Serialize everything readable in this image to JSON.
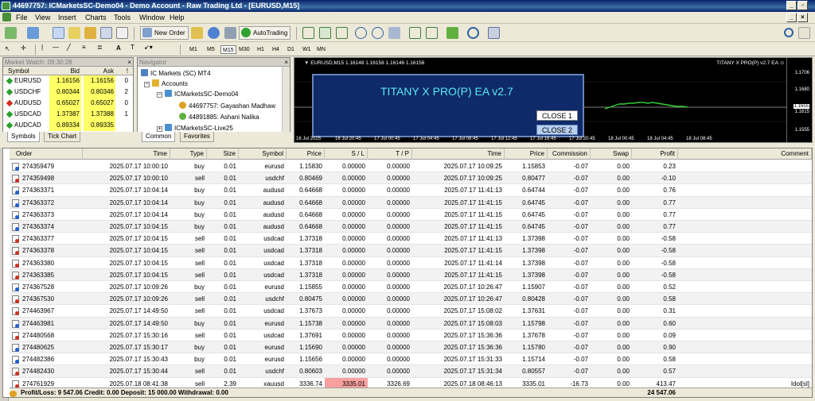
{
  "window": {
    "title": "44697757: ICMarketsSC-Demo04 - Demo Account - Raw Trading Ltd - [EURUSD,M15]"
  },
  "menu": [
    "File",
    "View",
    "Insert",
    "Charts",
    "Tools",
    "Window",
    "Help"
  ],
  "toolbar": {
    "new_order": "New Order",
    "auto_trading": "AutoTrading"
  },
  "timeframes": [
    "M1",
    "M5",
    "M15",
    "M30",
    "H1",
    "H4",
    "D1",
    "W1",
    "MN"
  ],
  "active_timeframe": "M15",
  "market_watch": {
    "title": "Market Watch: 09:30:28",
    "headers": {
      "symbol": "Symbol",
      "bid": "Bid",
      "ask": "Ask",
      "spread": "!"
    },
    "rows": [
      {
        "symbol": "EURUSD",
        "bid": "1.16156",
        "ask": "1.16156",
        "spread": "0",
        "icon_color": "#2aa02a",
        "bid_bg": "#ffff66",
        "ask_bg": "#ffff66"
      },
      {
        "symbol": "USDCHF",
        "bid": "0.80344",
        "ask": "0.80346",
        "spread": "2",
        "icon_color": "#2aa02a",
        "bid_bg": "#ffff66",
        "ask_bg": "#ffff66"
      },
      {
        "symbol": "AUDUSD",
        "bid": "0.65027",
        "ask": "0.65027",
        "spread": "0",
        "icon_color": "#d03020",
        "bid_bg": "#ffff66",
        "ask_bg": "#ffff66"
      },
      {
        "symbol": "USDCAD",
        "bid": "1.37387",
        "ask": "1.37388",
        "spread": "1",
        "icon_color": "#2aa02a",
        "bid_bg": "#ffff66",
        "ask_bg": "#ffff66"
      },
      {
        "symbol": "AUDCAD",
        "bid": "0.89334",
        "ask": "0.89335",
        "spread": "",
        "icon_color": "#2aa02a",
        "bid_bg": "#ffff66",
        "ask_bg": "#ffff66"
      }
    ],
    "tabs": [
      "Symbols",
      "Tick Chart"
    ]
  },
  "navigator": {
    "title": "Navigator",
    "root": "IC Markets (SC) MT4",
    "accounts": "Accounts",
    "server1": "ICMarketsSC-Demo04",
    "account1": "44697757: Gayashan Madhaw",
    "account2": "44891885: Ashani Nalika",
    "server2": "ICMarketsSC-Live25",
    "tabs": [
      "Common",
      "Favorites"
    ]
  },
  "chart": {
    "info": "EURUSD,M15  1.16148 1.16158 1.16146 1.16156",
    "ea_label": "TITANY X PRO(P) v2.7 EA",
    "ea_title": "TITANY X PRO(P) EA v2.7",
    "close1": "CLOSE 1",
    "close2": "CLOSE 2",
    "prices": [
      "1.1706",
      "1.1680",
      "1.1655",
      "1.1615",
      "1.1555"
    ],
    "times": [
      "16 Jul 2025",
      "16 Jul 20:45",
      "17 Jul 00:45",
      "17 Jul 04:45",
      "17 Jul 08:45",
      "17 Jul 12:45",
      "17 Jul 16:45",
      "17 Jul 20:45",
      "18 Jul 00:45",
      "18 Jul 04:45",
      "18 Jul 08:45"
    ]
  },
  "terminal": {
    "headers": {
      "order": "Order",
      "time": "Time",
      "type": "Type",
      "size": "Size",
      "symbol": "Symbol",
      "price": "Price",
      "sl": "S / L",
      "tp": "T / P",
      "time2": "Time",
      "price2": "Price",
      "commission": "Commission",
      "swap": "Swap",
      "profit": "Profit",
      "comment": "Comment"
    },
    "rows": [
      {
        "order": "274359479",
        "time": "2025.07.17 10:00:10",
        "type": "buy",
        "size": "0.01",
        "symbol": "eurusd",
        "price": "1.15830",
        "sl": "0.00000",
        "tp": "0.00000",
        "time2": "2025.07.17 10:09:25",
        "price2": "1.15853",
        "commission": "-0.07",
        "swap": "0.00",
        "profit": "0.23",
        "comment": ""
      },
      {
        "order": "274359498",
        "time": "2025.07.17 10:00:10",
        "type": "sell",
        "size": "0.01",
        "symbol": "usdchf",
        "price": "0.80469",
        "sl": "0.00000",
        "tp": "0.00000",
        "time2": "2025.07.17 10:09:25",
        "price2": "0.80477",
        "commission": "-0.07",
        "swap": "0.00",
        "profit": "-0.10",
        "comment": ""
      },
      {
        "order": "274363371",
        "time": "2025.07.17 10:04:14",
        "type": "buy",
        "size": "0.01",
        "symbol": "audusd",
        "price": "0.64668",
        "sl": "0.00000",
        "tp": "0.00000",
        "time2": "2025.07.17 11:41:13",
        "price2": "0.64744",
        "commission": "-0.07",
        "swap": "0.00",
        "profit": "0.76",
        "comment": ""
      },
      {
        "order": "274363372",
        "time": "2025.07.17 10:04:14",
        "type": "buy",
        "size": "0.01",
        "symbol": "audusd",
        "price": "0.64668",
        "sl": "0.00000",
        "tp": "0.00000",
        "time2": "2025.07.17 11:41:15",
        "price2": "0.64745",
        "commission": "-0.07",
        "swap": "0.00",
        "profit": "0.77",
        "comment": ""
      },
      {
        "order": "274363373",
        "time": "2025.07.17 10:04:14",
        "type": "buy",
        "size": "0.01",
        "symbol": "audusd",
        "price": "0.64668",
        "sl": "0.00000",
        "tp": "0.00000",
        "time2": "2025.07.17 11:41:15",
        "price2": "0.64745",
        "commission": "-0.07",
        "swap": "0.00",
        "profit": "0.77",
        "comment": ""
      },
      {
        "order": "274363374",
        "time": "2025.07.17 10:04:15",
        "type": "buy",
        "size": "0.01",
        "symbol": "audusd",
        "price": "0.64668",
        "sl": "0.00000",
        "tp": "0.00000",
        "time2": "2025.07.17 11:41:15",
        "price2": "0.64745",
        "commission": "-0.07",
        "swap": "0.00",
        "profit": "0.77",
        "comment": ""
      },
      {
        "order": "274363377",
        "time": "2025.07.17 10:04:15",
        "type": "sell",
        "size": "0.01",
        "symbol": "usdcad",
        "price": "1.37318",
        "sl": "0.00000",
        "tp": "0.00000",
        "time2": "2025.07.17 11:41:13",
        "price2": "1.37398",
        "commission": "-0.07",
        "swap": "0.00",
        "profit": "-0.58",
        "comment": ""
      },
      {
        "order": "274363378",
        "time": "2025.07.17 10:04:15",
        "type": "sell",
        "size": "0.01",
        "symbol": "usdcad",
        "price": "1.37318",
        "sl": "0.00000",
        "tp": "0.00000",
        "time2": "2025.07.17 11:41:15",
        "price2": "1.37398",
        "commission": "-0.07",
        "swap": "0.00",
        "profit": "-0.58",
        "comment": ""
      },
      {
        "order": "274363380",
        "time": "2025.07.17 10:04:15",
        "type": "sell",
        "size": "0.01",
        "symbol": "usdcad",
        "price": "1.37318",
        "sl": "0.00000",
        "tp": "0.00000",
        "time2": "2025.07.17 11:41:14",
        "price2": "1.37398",
        "commission": "-0.07",
        "swap": "0.00",
        "profit": "-0.58",
        "comment": ""
      },
      {
        "order": "274363385",
        "time": "2025.07.17 10:04:15",
        "type": "sell",
        "size": "0.01",
        "symbol": "usdcad",
        "price": "1.37318",
        "sl": "0.00000",
        "tp": "0.00000",
        "time2": "2025.07.17 11:41:15",
        "price2": "1.37398",
        "commission": "-0.07",
        "swap": "0.00",
        "profit": "-0.58",
        "comment": ""
      },
      {
        "order": "274367528",
        "time": "2025.07.17 10:09:26",
        "type": "buy",
        "size": "0.01",
        "symbol": "eurusd",
        "price": "1.15855",
        "sl": "0.00000",
        "tp": "0.00000",
        "time2": "2025.07.17 10:26:47",
        "price2": "1.15907",
        "commission": "-0.07",
        "swap": "0.00",
        "profit": "0.52",
        "comment": ""
      },
      {
        "order": "274367530",
        "time": "2025.07.17 10:09:26",
        "type": "sell",
        "size": "0.01",
        "symbol": "usdchf",
        "price": "0.80475",
        "sl": "0.00000",
        "tp": "0.00000",
        "time2": "2025.07.17 10:26:47",
        "price2": "0.80428",
        "commission": "-0.07",
        "swap": "0.00",
        "profit": "0.58",
        "comment": ""
      },
      {
        "order": "274463967",
        "time": "2025.07.17 14:49:50",
        "type": "sell",
        "size": "0.01",
        "symbol": "usdcad",
        "price": "1.37673",
        "sl": "0.00000",
        "tp": "0.00000",
        "time2": "2025.07.17 15:08:02",
        "price2": "1.37631",
        "commission": "-0.07",
        "swap": "0.00",
        "profit": "0.31",
        "comment": ""
      },
      {
        "order": "274463981",
        "time": "2025.07.17 14:49:50",
        "type": "buy",
        "size": "0.01",
        "symbol": "eurusd",
        "price": "1.15738",
        "sl": "0.00000",
        "tp": "0.00000",
        "time2": "2025.07.17 15:08:03",
        "price2": "1.15798",
        "commission": "-0.07",
        "swap": "0.00",
        "profit": "0.60",
        "comment": ""
      },
      {
        "order": "274480568",
        "time": "2025.07.17 15:30:16",
        "type": "sell",
        "size": "0.01",
        "symbol": "usdcad",
        "price": "1.37691",
        "sl": "0.00000",
        "tp": "0.00000",
        "time2": "2025.07.17 15:36:36",
        "price2": "1.37678",
        "commission": "-0.07",
        "swap": "0.00",
        "profit": "0.09",
        "comment": ""
      },
      {
        "order": "274480625",
        "time": "2025.07.17 15:30:17",
        "type": "buy",
        "size": "0.01",
        "symbol": "eurusd",
        "price": "1.15690",
        "sl": "0.00000",
        "tp": "0.00000",
        "time2": "2025.07.17 15:36:36",
        "price2": "1.15780",
        "commission": "-0.07",
        "swap": "0.00",
        "profit": "0.90",
        "comment": ""
      },
      {
        "order": "274482386",
        "time": "2025.07.17 15:30:43",
        "type": "buy",
        "size": "0.01",
        "symbol": "eurusd",
        "price": "1.15656",
        "sl": "0.00000",
        "tp": "0.00000",
        "time2": "2025.07.17 15:31:33",
        "price2": "1.15714",
        "commission": "-0.07",
        "swap": "0.00",
        "profit": "0.58",
        "comment": ""
      },
      {
        "order": "274482430",
        "time": "2025.07.17 15:30:44",
        "type": "sell",
        "size": "0.01",
        "symbol": "usdchf",
        "price": "0.80603",
        "sl": "0.00000",
        "tp": "0.00000",
        "time2": "2025.07.17 15:31:34",
        "price2": "0.80557",
        "commission": "-0.07",
        "swap": "0.00",
        "profit": "0.57",
        "comment": ""
      },
      {
        "order": "274761929",
        "time": "2025.07.18 08:41:38",
        "type": "sell",
        "size": "2.39",
        "symbol": "xauusd",
        "price": "3336.74",
        "sl": "3335.01",
        "tp": "3326.69",
        "time2": "2025.07.18 08:46:13",
        "price2": "3335.01",
        "commission": "-16.73",
        "swap": "0.00",
        "profit": "413.47",
        "comment": "Idol[sl]",
        "sl_hit": true
      }
    ],
    "footer": {
      "summary": "Profit/Loss: 9 547.06  Credit: 0.00  Deposit: 15 000.00  Withdrawal: 0.00",
      "total": "24 547.06"
    }
  }
}
